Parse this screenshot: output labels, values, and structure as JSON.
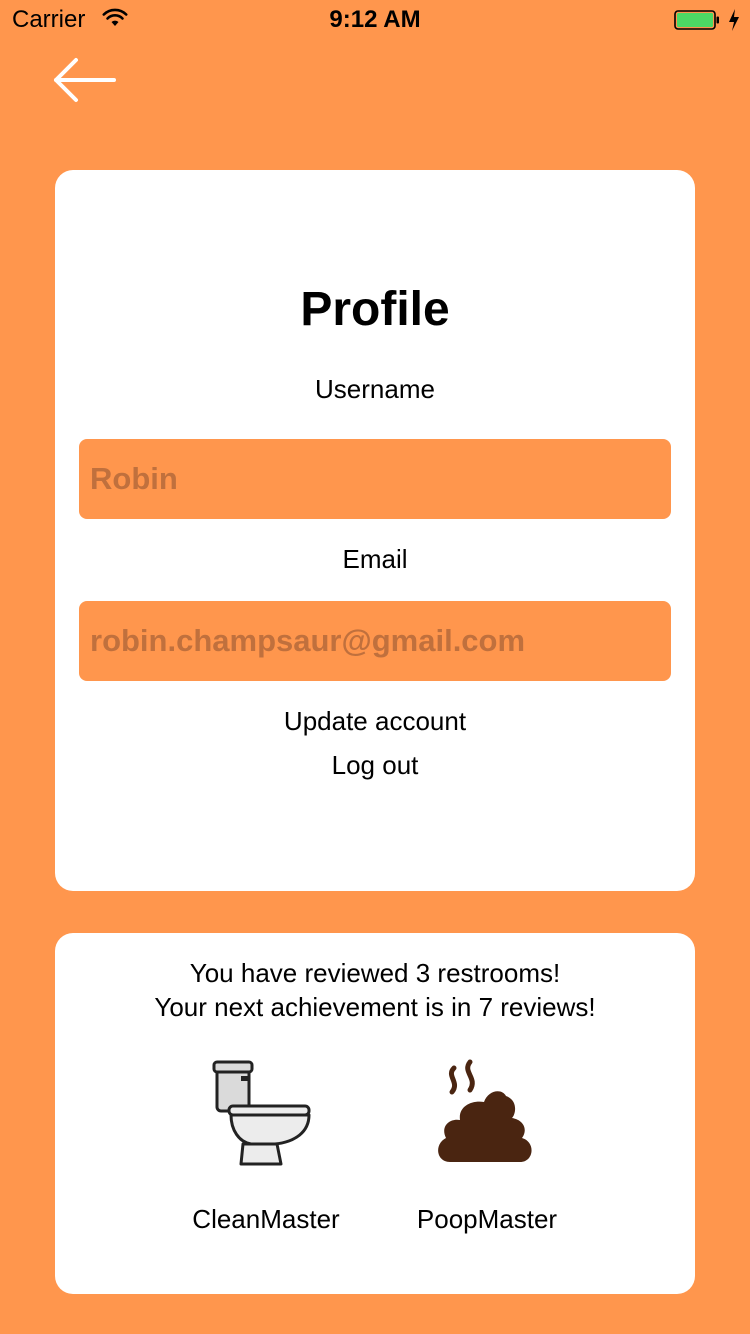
{
  "status_bar": {
    "carrier": "Carrier",
    "time": "9:12 AM",
    "battery_color": "#4CD964"
  },
  "colors": {
    "background": "#FF964D",
    "card": "#FFFFFF",
    "input_text": "#C0703D"
  },
  "header": {
    "back_icon": "arrow-left-icon"
  },
  "profile": {
    "title": "Profile",
    "username_label": "Username",
    "username_value": "Robin",
    "email_label": "Email",
    "email_value": "robin.champsaur@gmail.com",
    "update_label": "Update account",
    "logout_label": "Log out"
  },
  "achievements": {
    "line1": "You have reviewed 3 restrooms!",
    "line2": "Your next achievement is in 7 reviews!",
    "badges": [
      {
        "label": "CleanMaster",
        "icon": "toilet-icon"
      },
      {
        "label": "PoopMaster",
        "icon": "poop-icon"
      }
    ]
  }
}
